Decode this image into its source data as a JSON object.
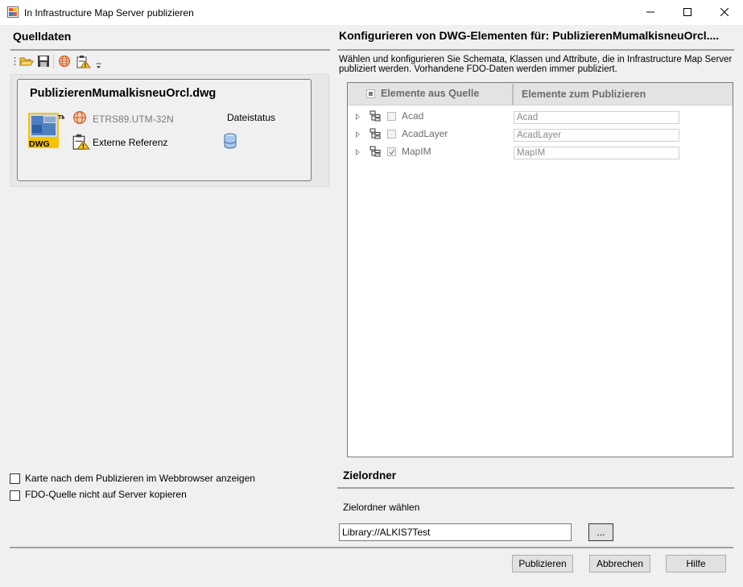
{
  "window": {
    "title": "In Infrastructure Map Server publizieren"
  },
  "left": {
    "section_title": "Quelldaten",
    "toolbar_icons": [
      "open-folder-icon",
      "save-icon",
      "globe-icon",
      "reference-warning-icon",
      "overflow-chevron-icon"
    ],
    "card": {
      "filename": "PublizierenMumalkisneuOrcl.dwg",
      "file_badge": "DWG",
      "coord_system": "ETRS89.UTM-32N",
      "status_label": "Dateistatus",
      "xref_label": "Externe Referenz"
    },
    "options": [
      {
        "label": "Karte nach dem Publizieren im Webbrowser anzeigen",
        "checked": false
      },
      {
        "label": "FDO-Quelle nicht auf Server kopieren",
        "checked": false
      }
    ]
  },
  "right": {
    "section_title": "Konfigurieren von DWG-Elementen für: PublizierenMumalkisneuOrcl....",
    "description_line1": "Wählen und konfigurieren Sie Schemata, Klassen und Attribute, die in Infrastructure Map Server",
    "description_line2": "publiziert werden. Vorhandene FDO-Daten werden immer publiziert.",
    "tree": {
      "col_source": "Elemente aus Quelle",
      "col_publish": "Elemente zum Publizieren",
      "rows": [
        {
          "label": "Acad",
          "publish_name": "Acad",
          "checked": false
        },
        {
          "label": "AcadLayer",
          "publish_name": "AcadLayer",
          "checked": false
        },
        {
          "label": "MapIM",
          "publish_name": "MapIM",
          "checked": true
        }
      ]
    },
    "target": {
      "section_title": "Zielordner",
      "choose_label": "Zielordner wählen",
      "path_value": "Library://ALKIS7Test",
      "browse_label": "..."
    }
  },
  "buttons": {
    "publish": "Publizieren",
    "cancel": "Abbrechen",
    "help": "Hilfe"
  }
}
